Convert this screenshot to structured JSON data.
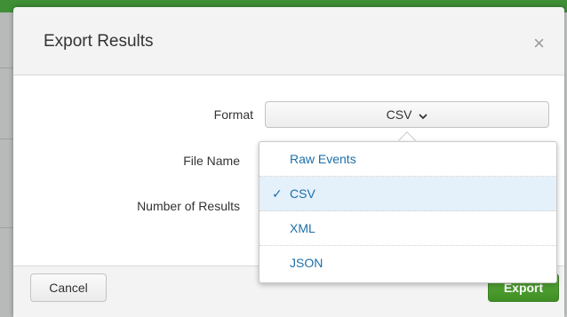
{
  "modal": {
    "title": "Export Results",
    "close_glyph": "×"
  },
  "form": {
    "format_label": "Format",
    "file_name_label": "File Name",
    "number_of_results_label": "Number of Results",
    "format_value": "CSV"
  },
  "dropdown": {
    "items": [
      {
        "label": "Raw Events",
        "selected": false
      },
      {
        "label": "CSV",
        "selected": true
      },
      {
        "label": "XML",
        "selected": false
      },
      {
        "label": "JSON",
        "selected": false
      }
    ],
    "check_glyph": "✓"
  },
  "footer": {
    "cancel_label": "Cancel",
    "export_label": "Export"
  },
  "colors": {
    "accent_green": "#3f8f25",
    "link_blue": "#1e6fa8",
    "selected_bg": "#e4f1fb"
  },
  "icons": {
    "close": "close-icon",
    "chevron": "chevron-down-icon",
    "check": "check-icon"
  }
}
